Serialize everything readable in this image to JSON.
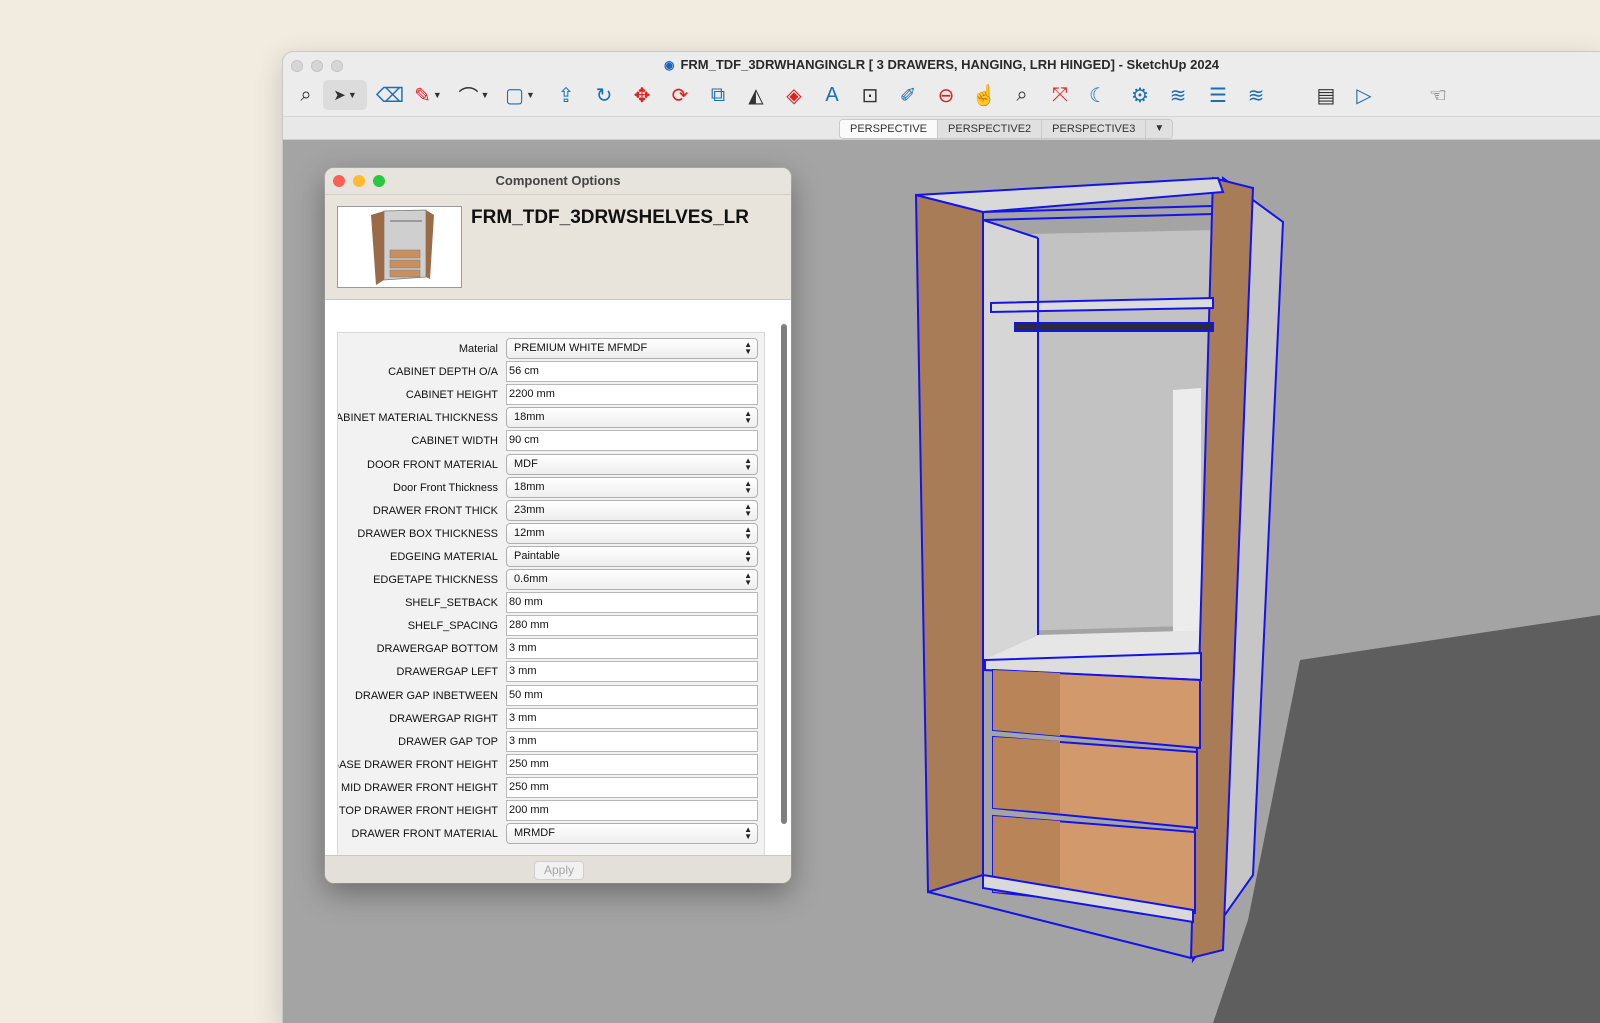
{
  "window": {
    "title": "FRM_TDF_3DRWHANGINGLR [ 3 DRAWERS, HANGING, LRH HINGED] - SketchUp 2024"
  },
  "toolbar": {
    "tools": [
      "search-icon",
      "select-arrow-icon",
      "eraser-icon",
      "pencil-line-icon",
      "arc-icon",
      "rectangle-icon",
      "push-pull-icon",
      "follow-me-icon",
      "move-icon",
      "rotate-icon",
      "scale-icon",
      "flip-icon",
      "paint-bucket-icon",
      "text-icon",
      "dimension-icon",
      "tape-measure-icon",
      "section-plane-icon",
      "pan-icon",
      "zoom-icon",
      "zoom-extents-icon",
      "orbit-icon",
      "component-icon",
      "solid-tools-icon",
      "layers-icon",
      "outliner-icon",
      "panel-icon",
      "scenes-icon",
      "hand-icon"
    ]
  },
  "scenes": {
    "tabs": [
      "PERSPECTIVE",
      "PERSPECTIVE2",
      "PERSPECTIVE3"
    ],
    "active": "PERSPECTIVE",
    "more": "▼"
  },
  "dialog": {
    "title": "Component Options",
    "component_name": "FRM_TDF_3DRWSHELVES_LR",
    "apply_label": "Apply",
    "options": [
      {
        "label": "Material",
        "value": "PREMIUM WHITE MFMDF",
        "type": "select"
      },
      {
        "label": "CABINET DEPTH O/A",
        "value": "56 cm",
        "type": "text"
      },
      {
        "label": "CABINET HEIGHT",
        "value": "2200 mm",
        "type": "text"
      },
      {
        "label": "CABINET MATERIAL THICKNESS",
        "value": "18mm",
        "type": "select"
      },
      {
        "label": "CABINET WIDTH",
        "value": "90 cm",
        "type": "text"
      },
      {
        "label": "DOOR FRONT MATERIAL",
        "value": "MDF",
        "type": "select"
      },
      {
        "label": "Door Front Thickness",
        "value": "18mm",
        "type": "select"
      },
      {
        "label": "DRAWER FRONT THICK",
        "value": "23mm",
        "type": "select"
      },
      {
        "label": "DRAWER BOX THICKNESS",
        "value": "12mm",
        "type": "select"
      },
      {
        "label": "EDGEING MATERIAL",
        "value": "Paintable",
        "type": "select"
      },
      {
        "label": "EDGETAPE THICKNESS",
        "value": "0.6mm",
        "type": "select"
      },
      {
        "label": "SHELF_SETBACK",
        "value": "80 mm",
        "type": "text"
      },
      {
        "label": "SHELF_SPACING",
        "value": "280 mm",
        "type": "text"
      },
      {
        "label": "DRAWERGAP BOTTOM",
        "value": "3 mm",
        "type": "text"
      },
      {
        "label": "DRAWERGAP LEFT",
        "value": "3 mm",
        "type": "text"
      },
      {
        "label": "DRAWER GAP INBETWEEN",
        "value": "50 mm",
        "type": "text"
      },
      {
        "label": "DRAWERGAP RIGHT",
        "value": "3 mm",
        "type": "text"
      },
      {
        "label": "DRAWER GAP TOP",
        "value": "3 mm",
        "type": "text"
      },
      {
        "label": "BASE DRAWER FRONT HEIGHT",
        "value": "250 mm",
        "type": "text"
      },
      {
        "label": "MID DRAWER FRONT HEIGHT",
        "value": "250 mm",
        "type": "text"
      },
      {
        "label": "TOP DRAWER FRONT HEIGHT",
        "value": "200 mm",
        "type": "text"
      },
      {
        "label": "DRAWER FRONT MATERIAL",
        "value": "MRMDF",
        "type": "select"
      }
    ]
  },
  "colors": {
    "selection_edge": "#1414e6",
    "wood": "#a97c58",
    "drawer_wood": "#d29a6c",
    "ground_shadow": "#5e5e5e"
  }
}
